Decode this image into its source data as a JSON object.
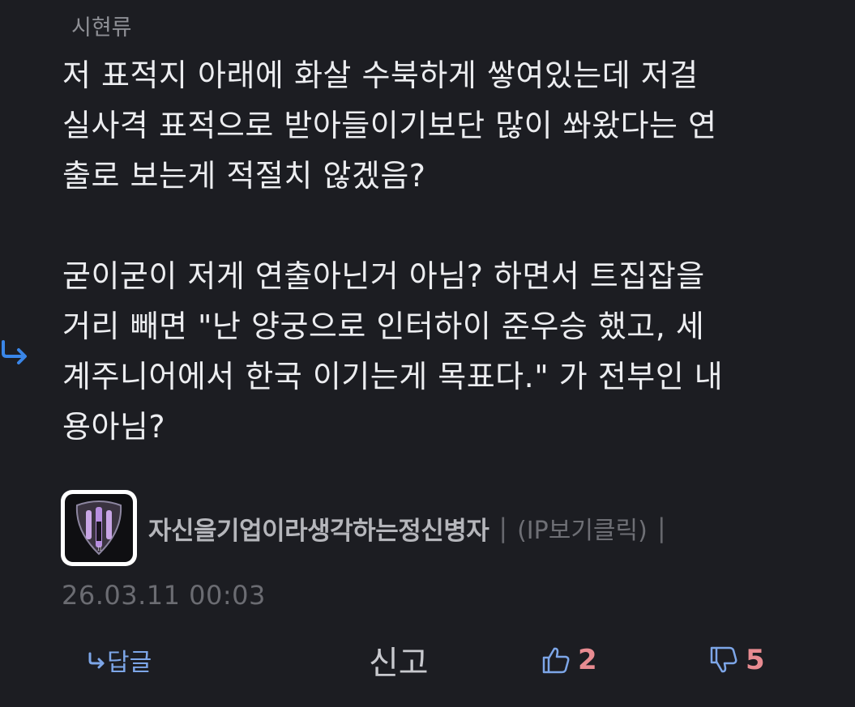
{
  "header": {
    "tag": "시현류"
  },
  "comment": {
    "lines_para1": [
      "저 표적지 아래에 화살 수북하게 쌓여있는데 저걸",
      "실사격 표적으로 받아들이기보단 많이 쏴왔다는 연",
      "출로 보는게 적절치 않겠음?"
    ],
    "lines_para2": [
      "굳이굳이 저게 연출아닌거 아님? 하면서 트집잡을",
      "거리 빼면 \"난 양궁으로 인터하이 준우승 했고, 세",
      "계주니어에서 한국 이기는게 목표다.\" 가 전부인 내",
      "용아님?"
    ]
  },
  "author": {
    "name": "자신을기업이라생각하는정신병자",
    "separator": "|",
    "ip_link": "(IP보기클릭)",
    "separator_end": "|"
  },
  "timestamp": "26.03.11 00:03",
  "actions": {
    "reply_label": "답글",
    "report_label": "신고",
    "like_count": "2",
    "dislike_count": "5"
  },
  "colors": {
    "background": "#1c1d22",
    "reply_accent": "#7da6e8",
    "vote_accent": "#e88b91"
  }
}
